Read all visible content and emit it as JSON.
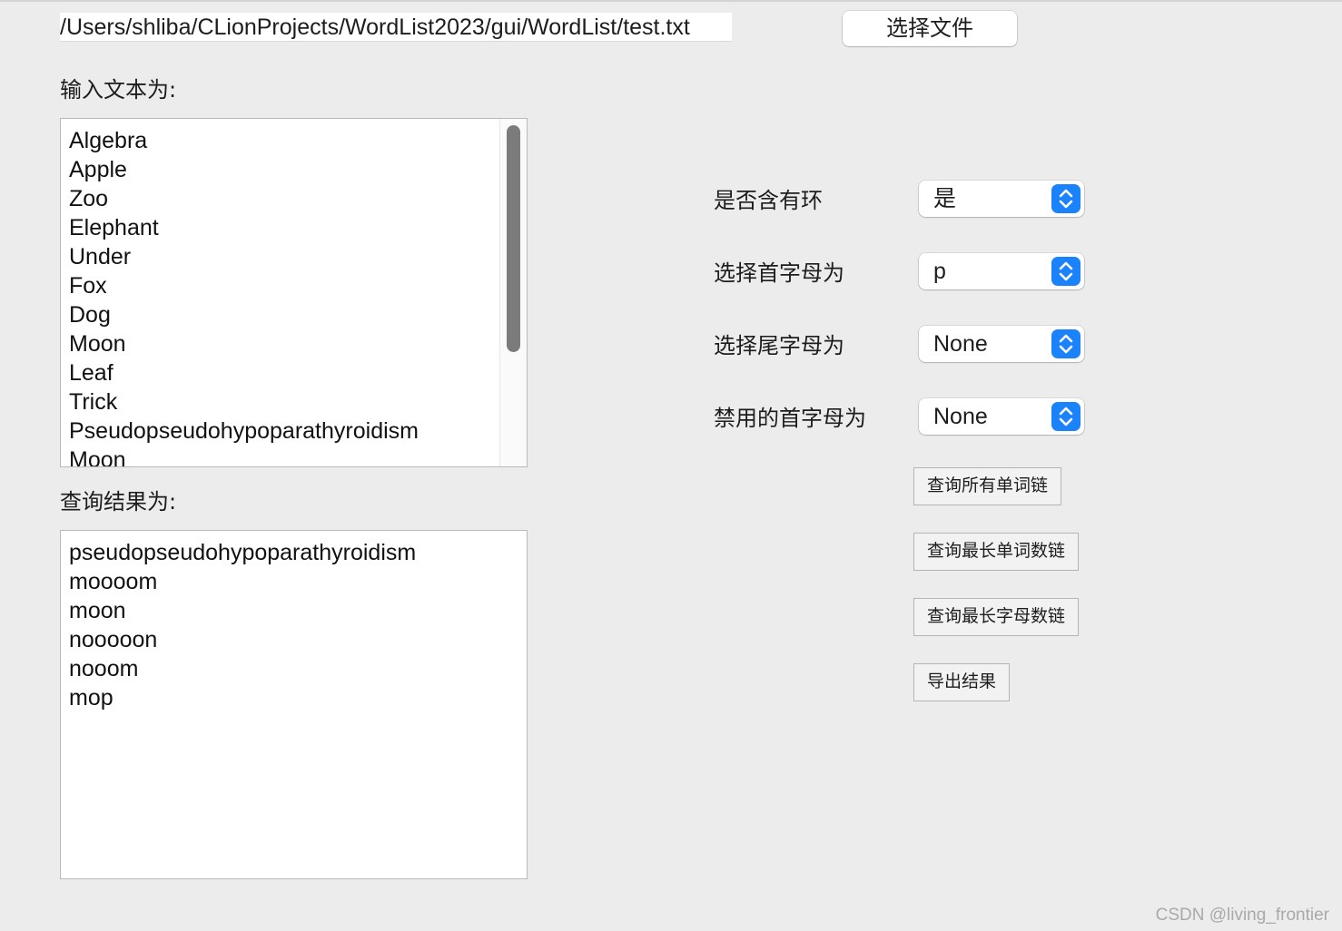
{
  "file_path": "/Users/shliba/CLionProjects/WordList2023/gui/WordList/test.txt",
  "choose_file_button": "选择文件",
  "input_label": "输入文本为:",
  "input_lines": [
    "Algebra",
    "Apple",
    "Zoo",
    "Elephant",
    "Under",
    "Fox",
    "Dog",
    "Moon",
    "Leaf",
    "Trick",
    "Pseudopseudohypoparathyroidism",
    "Moon"
  ],
  "result_label": "查询结果为:",
  "result_lines": [
    "pseudopseudohypoparathyroidism",
    "moooom",
    "moon",
    "nooooon",
    "nooom",
    "mop"
  ],
  "options": {
    "has_cycle": {
      "label": "是否含有环",
      "value": "是"
    },
    "head_letter": {
      "label": "选择首字母为",
      "value": "p"
    },
    "tail_letter": {
      "label": "选择尾字母为",
      "value": "None"
    },
    "banned_head": {
      "label": "禁用的首字母为",
      "value": "None"
    }
  },
  "buttons": {
    "query_all_chains": "查询所有单词链",
    "query_longest_word_chain": "查询最长单词数链",
    "query_longest_char_chain": "查询最长字母数链",
    "export_result": "导出结果"
  },
  "watermark": "CSDN @living_frontier",
  "colors": {
    "background": "#ececec",
    "accent": "#1a82fb"
  }
}
